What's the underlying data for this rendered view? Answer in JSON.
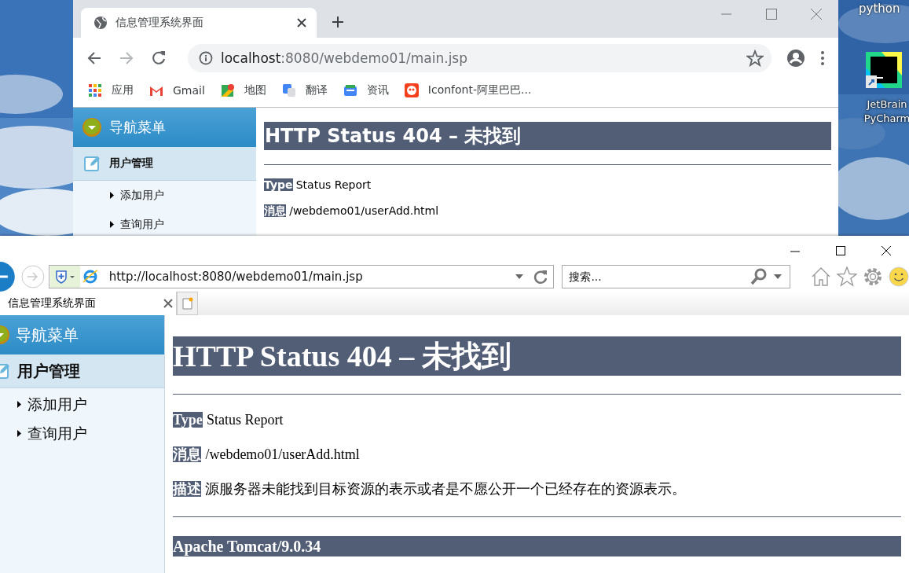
{
  "desktop": {
    "labels": [
      "python"
    ],
    "shortcut": {
      "lines": [
        "JetBrain",
        "PyCharm"
      ]
    }
  },
  "chrome": {
    "tabs": [
      {
        "title": "信息管理系统界面",
        "selected": true
      }
    ],
    "address": {
      "host": "localhost",
      "path": ":8080/webdemo01/main.jsp"
    },
    "bookmarks": [
      "应用",
      "Gmail",
      "地图",
      "翻译",
      "资讯",
      "Iconfont-阿里巴巴..."
    ],
    "sidebar": {
      "header": "导航菜单",
      "group": "用户管理",
      "items": [
        "添加用户",
        "查询用户"
      ]
    },
    "page": {
      "heading": "HTTP Status 404 – 未找到",
      "fields": [
        {
          "label": "Type",
          "value": "Status Report"
        },
        {
          "label": "消息",
          "value": "/webdemo01/userAdd.html"
        }
      ]
    }
  },
  "ie": {
    "address": "http://localhost:8080/webdemo01/main.jsp",
    "search": {
      "placeholder": "搜索..."
    },
    "tabs": [
      {
        "title": "信息管理系统界面",
        "selected": true
      }
    ],
    "sidebar": {
      "header": "导航菜单",
      "group": "用户管理",
      "items": [
        "添加用户",
        "查询用户"
      ]
    },
    "page": {
      "heading": "HTTP Status 404 – 未找到",
      "fields": [
        {
          "label": "Type",
          "value": "Status Report"
        },
        {
          "label": "消息",
          "value": "/webdemo01/userAdd.html"
        },
        {
          "label": "描述",
          "value": "源服务器未能找到目标资源的表示或者是不愿公开一个已经存在的资源表示。"
        }
      ],
      "footer": "Apache Tomcat/9.0.34"
    }
  }
}
